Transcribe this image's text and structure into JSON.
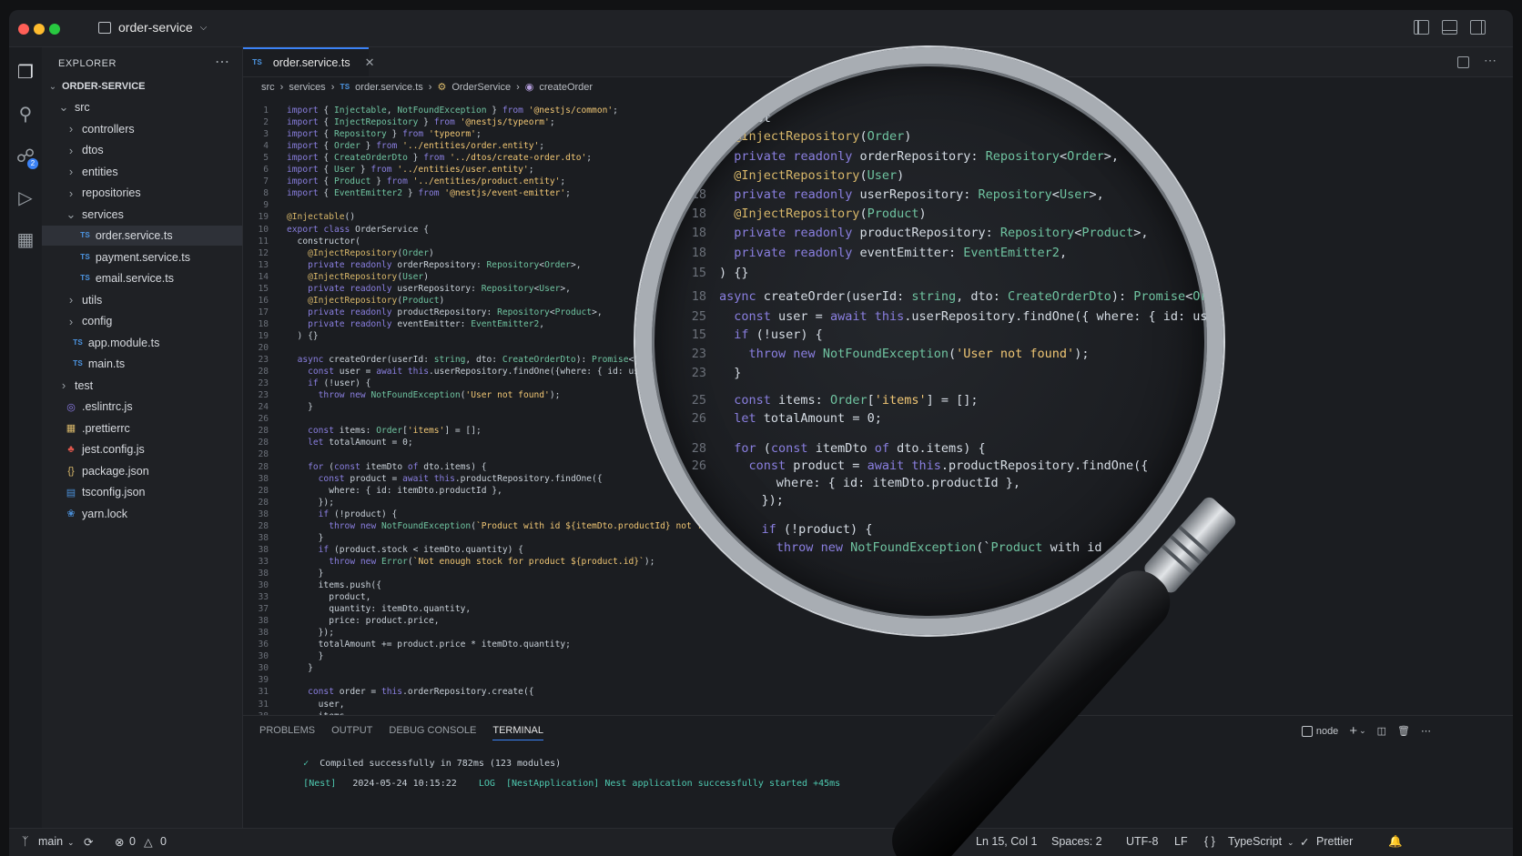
{
  "window": {
    "title": "order-service",
    "colors": {
      "close": "#ff5f57",
      "minimize": "#febc2e",
      "maximize": "#28c840",
      "accent": "#3b82f6"
    }
  },
  "sidebar": {
    "header": "EXPLORER",
    "project": "ORDER-SERVICE",
    "items": [
      {
        "label": "src",
        "depth": 0,
        "kind": "folder-open"
      },
      {
        "label": "controllers",
        "depth": 1,
        "kind": "folder"
      },
      {
        "label": "dtos",
        "depth": 1,
        "kind": "folder"
      },
      {
        "label": "entities",
        "depth": 1,
        "kind": "folder"
      },
      {
        "label": "repositories",
        "depth": 1,
        "kind": "folder"
      },
      {
        "label": "services",
        "depth": 1,
        "kind": "folder-open"
      },
      {
        "label": "order.service.ts",
        "depth": 2,
        "kind": "ts",
        "active": true
      },
      {
        "label": "payment.service.ts",
        "depth": 2,
        "kind": "ts"
      },
      {
        "label": "email.service.ts",
        "depth": 2,
        "kind": "ts"
      },
      {
        "label": "utils",
        "depth": 1,
        "kind": "folder"
      },
      {
        "label": "config",
        "depth": 1,
        "kind": "folder"
      },
      {
        "label": "app.module.ts",
        "depth": 1,
        "kind": "ts"
      },
      {
        "label": "main.ts",
        "depth": 1,
        "kind": "ts"
      },
      {
        "label": "test",
        "depth": 0,
        "kind": "folder"
      },
      {
        "label": ".eslintrc.js",
        "depth": 0,
        "kind": "eslint"
      },
      {
        "label": ".prettierrc",
        "depth": 0,
        "kind": "prettier"
      },
      {
        "label": "jest.config.js",
        "depth": 0,
        "kind": "jest"
      },
      {
        "label": "package.json",
        "depth": 0,
        "kind": "json"
      },
      {
        "label": "tsconfig.json",
        "depth": 0,
        "kind": "tsconfig"
      },
      {
        "label": "yarn.lock",
        "depth": 0,
        "kind": "yarn"
      }
    ]
  },
  "editor": {
    "tab": {
      "badge": "TS",
      "label": "order.service.ts"
    },
    "breadcrumb": [
      "src",
      "services",
      "order.service.ts",
      "OrderService",
      "createOrder"
    ],
    "lines": [
      {
        "n": "1",
        "t": "import { Injectable, NotFoundException } from '@nestjs/common';"
      },
      {
        "n": "2",
        "t": "import { InjectRepository } from '@nestjs/typeorm';"
      },
      {
        "n": "3",
        "t": "import { Repository } from 'typeorm';"
      },
      {
        "n": "4",
        "t": "import { Order } from '../entities/order.entity';"
      },
      {
        "n": "5",
        "t": "import { CreateOrderDto } from '../dtos/create-order.dto';"
      },
      {
        "n": "6",
        "t": "import { User } from '../entities/user.entity';"
      },
      {
        "n": "7",
        "t": "import { Product } from '../entities/product.entity';"
      },
      {
        "n": "8",
        "t": "import { EventEmitter2 } from '@nestjs/event-emitter';"
      },
      {
        "n": "9",
        "t": ""
      },
      {
        "n": "19",
        "t": "@Injectable()"
      },
      {
        "n": "10",
        "t": "export class OrderService {"
      },
      {
        "n": "11",
        "t": "  constructor("
      },
      {
        "n": "12",
        "t": "    @InjectRepository(Order)"
      },
      {
        "n": "13",
        "t": "    private readonly orderRepository: Repository<Order>,"
      },
      {
        "n": "14",
        "t": "    @InjectRepository(User)"
      },
      {
        "n": "15",
        "t": "    private readonly userRepository: Repository<User>,"
      },
      {
        "n": "16",
        "t": "    @InjectRepository(Product)"
      },
      {
        "n": "17",
        "t": "    private readonly productRepository: Repository<Product>,"
      },
      {
        "n": "18",
        "t": "    private readonly eventEmitter: EventEmitter2,"
      },
      {
        "n": "19",
        "t": "  ) {}"
      },
      {
        "n": "20",
        "t": ""
      },
      {
        "n": "23",
        "t": "  async createOrder(userId: string, dto: CreateOrderDto): Promise<Order> {"
      },
      {
        "n": "28",
        "t": "    const user = await this.userRepository.findOne({where: { id: userId } });"
      },
      {
        "n": "23",
        "t": "    if (!user) {"
      },
      {
        "n": "23",
        "t": "      throw new NotFoundException('User not found');"
      },
      {
        "n": "24",
        "t": "    }"
      },
      {
        "n": "26",
        "t": ""
      },
      {
        "n": "28",
        "t": "    const items: Order['items'] = [];"
      },
      {
        "n": "28",
        "t": "    let totalAmount = 0;"
      },
      {
        "n": "28",
        "t": ""
      },
      {
        "n": "28",
        "t": "    for (const itemDto of dto.items) {"
      },
      {
        "n": "38",
        "t": "      const product = await this.productRepository.findOne({"
      },
      {
        "n": "28",
        "t": "        where: { id: itemDto.productId },"
      },
      {
        "n": "28",
        "t": "      });"
      },
      {
        "n": "38",
        "t": "      if (!product) {"
      },
      {
        "n": "28",
        "t": "        throw new NotFoundException(`Product with id ${itemDto.productId} not found`);"
      },
      {
        "n": "38",
        "t": "      }"
      },
      {
        "n": "38",
        "t": "      if (product.stock < itemDto.quantity) {"
      },
      {
        "n": "33",
        "t": "        throw new Error(`Not enough stock for product ${product.id}`);"
      },
      {
        "n": "38",
        "t": "      }"
      },
      {
        "n": "30",
        "t": "      items.push({"
      },
      {
        "n": "33",
        "t": "        product,"
      },
      {
        "n": "37",
        "t": "        quantity: itemDto.quantity,"
      },
      {
        "n": "38",
        "t": "        price: product.price,"
      },
      {
        "n": "38",
        "t": "      });"
      },
      {
        "n": "36",
        "t": "      totalAmount += product.price * itemDto.quantity;"
      },
      {
        "n": "30",
        "t": "      }"
      },
      {
        "n": "30",
        "t": "    }"
      },
      {
        "n": "39",
        "t": ""
      },
      {
        "n": "31",
        "t": "    const order = this.orderRepository.create({"
      },
      {
        "n": "31",
        "t": "      user,"
      },
      {
        "n": "38",
        "t": "      items,"
      }
    ],
    "magnified": [
      {
        "n": "",
        "t": "  ...ot"
      },
      {
        "n": "",
        "t": "  @InjectRepository(Order)"
      },
      {
        "n": "",
        "t": "  private readonly orderRepository: Repository<Order>,"
      },
      {
        "n": "",
        "t": "  @InjectRepository(User)"
      },
      {
        "n": "18",
        "t": "  private readonly userRepository: Repository<User>,"
      },
      {
        "n": "18",
        "t": "  @InjectRepository(Product)"
      },
      {
        "n": "18",
        "t": "  private readonly productRepository: Repository<Product>,"
      },
      {
        "n": "18",
        "t": "  private readonly eventEmitter: EventEmitter2,"
      },
      {
        "n": "15",
        "t": ") {}"
      },
      {
        "n": "18",
        "t": "async createOrder(userId: string, dto: CreateOrderDto): Promise<Order>"
      },
      {
        "n": "25",
        "t": "  const user = await this.userRepository.findOne({ where: { id: userId"
      },
      {
        "n": "15",
        "t": "  if (!user) {"
      },
      {
        "n": "23",
        "t": "    throw new NotFoundException('User not found');"
      },
      {
        "n": "23",
        "t": "  }"
      },
      {
        "n": "25",
        "t": "  const items: Order['items'] = [];"
      },
      {
        "n": "26",
        "t": "  let totalAmount = 0;"
      },
      {
        "n": "28",
        "t": "  for (const itemDto of dto.items) {"
      },
      {
        "n": "26",
        "t": "    const product = await this.productRepository.findOne({"
      },
      {
        "n": "",
        "t": "      where: { id: itemDto.productId },"
      },
      {
        "n": "",
        "t": "    });"
      },
      {
        "n": "",
        "t": "    if (!product) {"
      },
      {
        "n": "",
        "t": "      throw new NotFoundException(`Product with id"
      }
    ]
  },
  "panel": {
    "tabs": [
      "PROBLEMS",
      "OUTPUT",
      "DEBUG CONSOLE",
      "TERMINAL"
    ],
    "active_tab": "TERMINAL",
    "shell": "node",
    "terminal": [
      {
        "prefix": "✓",
        "text": "Compiled successfully in 782ms (123 modules)"
      },
      {
        "prefix": "[Nest]",
        "ts": "2024-05-24 10:15:22",
        "level": "LOG",
        "text": "[NestApplication] Nest application successfully started +45ms"
      }
    ]
  },
  "status": {
    "branch": "main",
    "errors": "0",
    "warnings": "0",
    "position": "Ln 15, Col 1",
    "spaces": "Spaces: 2",
    "encoding": "UTF-8",
    "eol": "LF",
    "language": "TypeScript",
    "formatter": "Prettier"
  }
}
